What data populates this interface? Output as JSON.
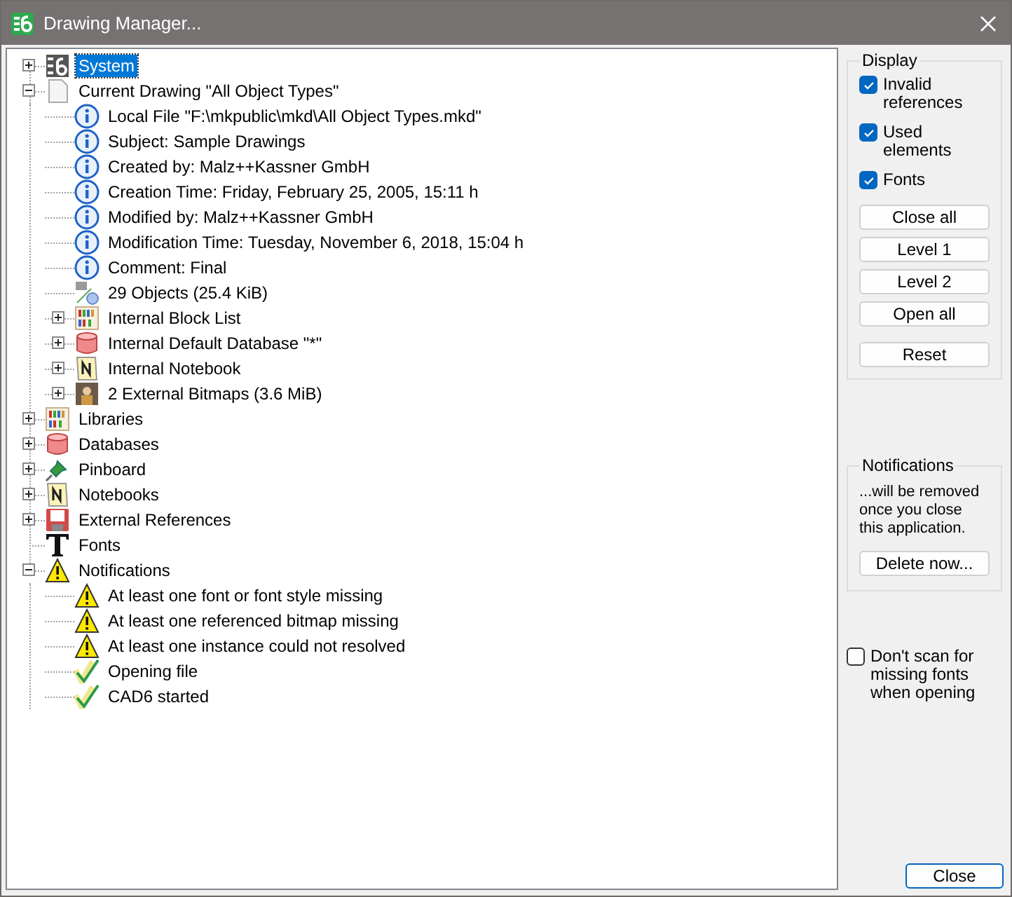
{
  "window": {
    "title": "Drawing Manager..."
  },
  "tree": [
    {
      "label": "System",
      "kind": "logo",
      "selected": true,
      "expanded": false
    },
    {
      "label": "Current Drawing \"All Object Types\"",
      "kind": "page",
      "selected": false,
      "expanded": true,
      "children": [
        {
          "label": "Local File \"F:\\mkpublic\\mkd\\All Object Types.mkd\"",
          "kind": "info",
          "selected": false
        },
        {
          "label": "Subject: Sample Drawings",
          "kind": "info",
          "selected": false
        },
        {
          "label": "Created by: Malz++Kassner GmbH",
          "kind": "info",
          "selected": false
        },
        {
          "label": "Creation Time: Friday, February 25, 2005, 15:11 h",
          "kind": "info",
          "selected": false
        },
        {
          "label": "Modified by: Malz++Kassner GmbH",
          "kind": "info",
          "selected": false
        },
        {
          "label": "Modification Time: Tuesday, November 6, 2018, 15:04 h",
          "kind": "info",
          "selected": false
        },
        {
          "label": "Comment: Final",
          "kind": "info",
          "selected": false
        },
        {
          "label": "29 Objects (25.4 KiB)",
          "kind": "objects",
          "selected": false
        },
        {
          "label": "Internal Block List",
          "kind": "blocks",
          "selected": false,
          "expanded": false
        },
        {
          "label": "Internal Default Database \"*\"",
          "kind": "database",
          "selected": false,
          "expanded": false
        },
        {
          "label": "Internal Notebook",
          "kind": "notebook",
          "selected": false,
          "expanded": false
        },
        {
          "label": "2 External Bitmaps (3.6 MiB)",
          "kind": "bitmap",
          "selected": false,
          "expanded": false
        }
      ]
    },
    {
      "label": "Libraries",
      "kind": "blocks",
      "selected": false,
      "expanded": false
    },
    {
      "label": "Databases",
      "kind": "database",
      "selected": false,
      "expanded": false
    },
    {
      "label": "Pinboard",
      "kind": "pin",
      "selected": false,
      "expanded": false
    },
    {
      "label": "Notebooks",
      "kind": "notebook",
      "selected": false,
      "expanded": false
    },
    {
      "label": "External References",
      "kind": "floppy",
      "selected": false,
      "expanded": false
    },
    {
      "label": "Fonts",
      "kind": "font",
      "selected": false
    },
    {
      "label": "Notifications",
      "kind": "warning",
      "selected": false,
      "expanded": true,
      "children": [
        {
          "label": "At least one font or font style missing",
          "kind": "warning",
          "selected": false
        },
        {
          "label": "At least one referenced bitmap missing",
          "kind": "warning",
          "selected": false
        },
        {
          "label": "At least one instance could not resolved",
          "kind": "warning",
          "selected": false
        },
        {
          "label": "Opening file",
          "kind": "check",
          "selected": false
        },
        {
          "label": "CAD6 started",
          "kind": "check",
          "selected": false
        }
      ]
    }
  ],
  "display": {
    "title": "Display",
    "options": [
      {
        "label": "Invalid references",
        "checked": true
      },
      {
        "label": "Used elements",
        "checked": true
      },
      {
        "label": "Fonts",
        "checked": true
      }
    ],
    "buttons": [
      "Close all",
      "Level 1",
      "Level 2",
      "Open all",
      "Reset"
    ]
  },
  "notifications": {
    "title": "Notifications",
    "text": "...will be removed once you close this application.",
    "button": "Delete now..."
  },
  "scan_option": {
    "label": "Don't scan for missing fonts when opening",
    "checked": false
  },
  "close_button": "Close"
}
